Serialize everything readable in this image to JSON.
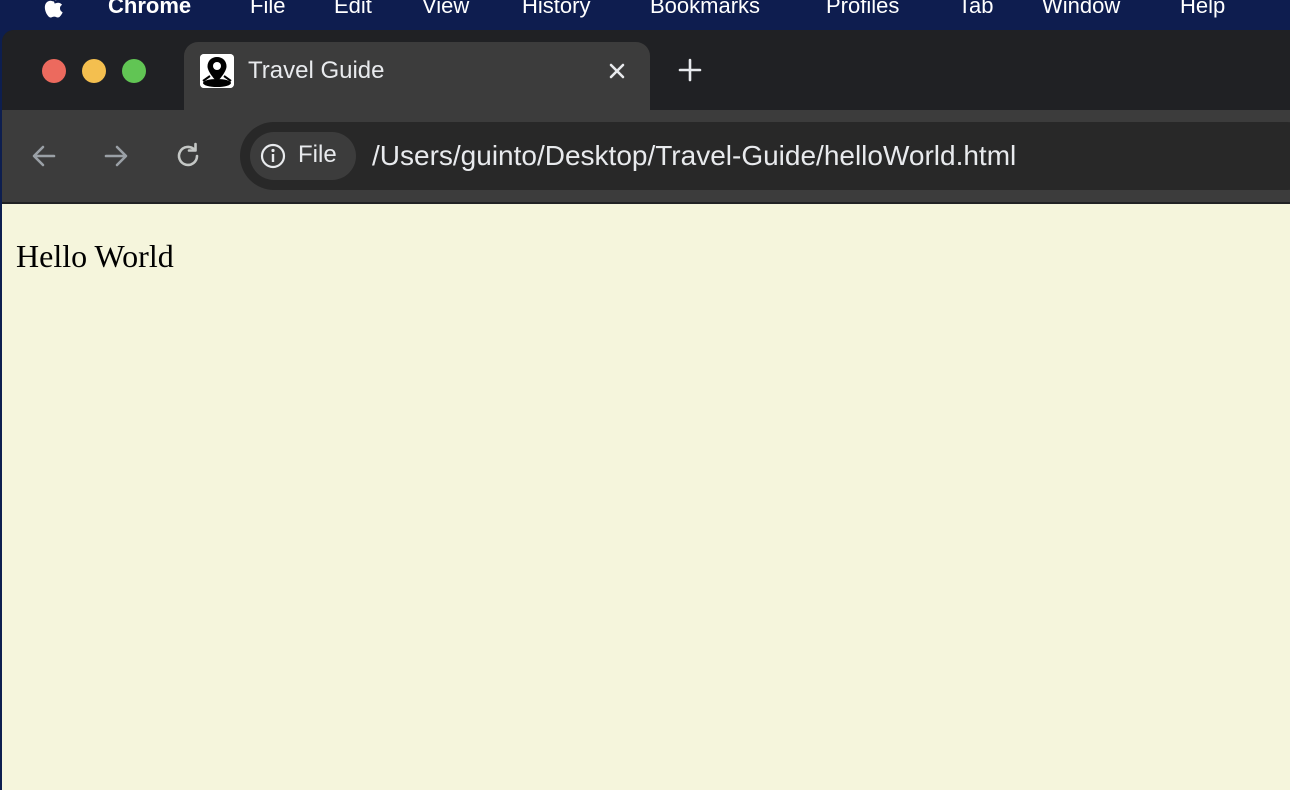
{
  "menubar": {
    "app_name": "Chrome",
    "items": [
      "File",
      "Edit",
      "View",
      "History",
      "Bookmarks",
      "Profiles",
      "Tab",
      "Window",
      "Help"
    ]
  },
  "tab": {
    "title": "Travel Guide",
    "favicon": "map-pin-icon"
  },
  "toolbar": {
    "site_info_label": "File",
    "url": "/Users/guinto/Desktop/Travel-Guide/helloWorld.html"
  },
  "page": {
    "heading_text": "Hello World",
    "background_color": "#f5f5dc"
  },
  "colors": {
    "menubar_bg": "#0e1d4f",
    "tabstrip_bg": "#202124",
    "toolbar_bg": "#3c3c3c",
    "close_red": "#ec6a5e",
    "minimize_yellow": "#f4bf4f",
    "zoom_green": "#61c554"
  }
}
